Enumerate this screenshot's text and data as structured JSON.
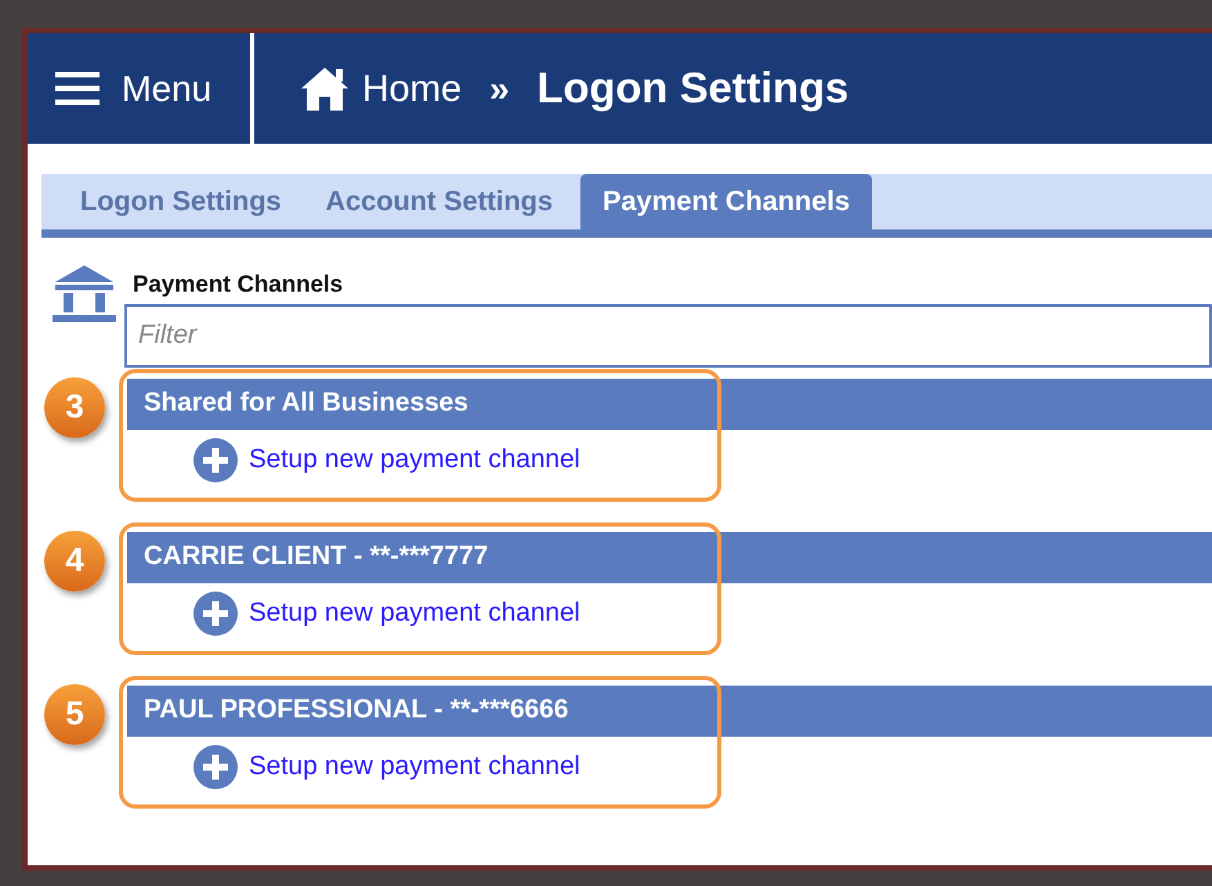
{
  "header": {
    "menu_label": "Menu",
    "breadcrumb_home": "Home",
    "breadcrumb_separator": "»",
    "page_title": "Logon Settings"
  },
  "tabs": [
    {
      "label": "Logon Settings",
      "selected": false
    },
    {
      "label": "Account Settings",
      "selected": false
    },
    {
      "label": "Payment Channels",
      "selected": true
    }
  ],
  "panel": {
    "title": "Payment Channels",
    "filter": {
      "placeholder": "Filter"
    }
  },
  "sections": [
    {
      "callout": "3",
      "title": "Shared for All Businesses",
      "link": "Setup new payment channel"
    },
    {
      "callout": "4",
      "title": "CARRIE CLIENT - **-***7777",
      "link": "Setup new payment channel"
    },
    {
      "callout": "5",
      "title": "PAUL PROFESSIONAL - **-***6666",
      "link": "Setup new payment channel"
    }
  ]
}
